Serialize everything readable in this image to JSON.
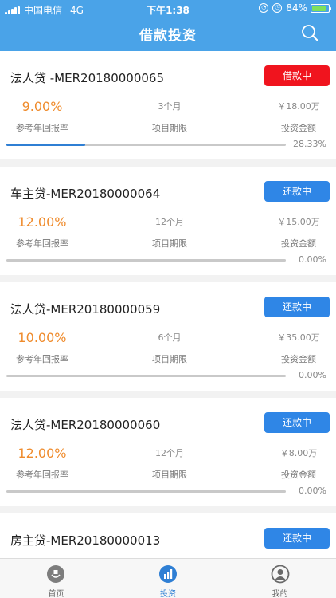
{
  "status_bar": {
    "carrier": "中国电信",
    "network": "4G",
    "time": "下午1:38",
    "battery": "84%",
    "battery_level": 0.84
  },
  "nav": {
    "title": "借款投资",
    "search_icon": "search-icon"
  },
  "colors": {
    "primary": "#4aa3e8",
    "accent_rate": "#ef8b2c",
    "status_red": "#f0141e",
    "status_blue": "#2f86e6",
    "progress_blue": "#2f7fd4"
  },
  "loans": [
    {
      "title": "法人贷 -MER20180000065",
      "status": "借款中",
      "status_color": "#f0141e",
      "rate": "9.00%",
      "rate_label": "参考年回报率",
      "term": "3个月",
      "term_label": "项目期限",
      "amount": "￥18.00万",
      "amount_label": "投资金额",
      "progress": "28.33%",
      "progress_value": 0.2833
    },
    {
      "title": "车主贷-MER20180000064",
      "status": "还款中",
      "status_color": "#2f86e6",
      "rate": "12.00%",
      "rate_label": "参考年回报率",
      "term": "12个月",
      "term_label": "项目期限",
      "amount": "￥15.00万",
      "amount_label": "投资金额",
      "progress": "0.00%",
      "progress_value": 0
    },
    {
      "title": "法人贷-MER20180000059",
      "status": "还款中",
      "status_color": "#2f86e6",
      "rate": "10.00%",
      "rate_label": "参考年回报率",
      "term": "6个月",
      "term_label": "项目期限",
      "amount": "￥35.00万",
      "amount_label": "投资金额",
      "progress": "0.00%",
      "progress_value": 0
    },
    {
      "title": "法人贷-MER20180000060",
      "status": "还款中",
      "status_color": "#2f86e6",
      "rate": "12.00%",
      "rate_label": "参考年回报率",
      "term": "12个月",
      "term_label": "项目期限",
      "amount": "￥8.00万",
      "amount_label": "投资金额",
      "progress": "0.00%",
      "progress_value": 0
    },
    {
      "title": "房主贷-MER20180000013",
      "status": "还款中",
      "status_color": "#2f86e6"
    }
  ],
  "tabs": [
    {
      "label": "首页",
      "icon": "home-hands-icon"
    },
    {
      "label": "投资",
      "icon": "chart-icon",
      "active": true
    },
    {
      "label": "我的",
      "icon": "user-icon"
    }
  ]
}
